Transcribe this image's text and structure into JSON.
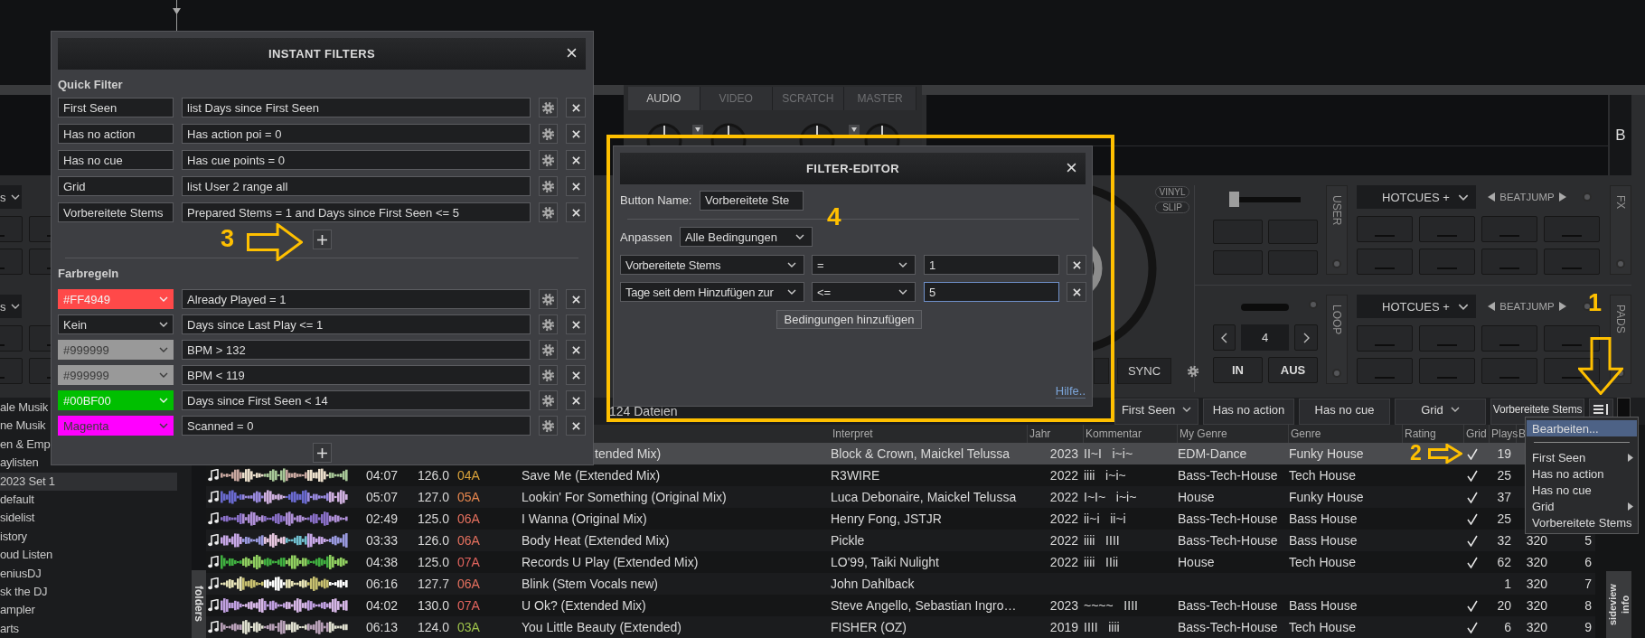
{
  "left_deck": {
    "hotcue_banks": [
      {
        "mode": "s"
      },
      {
        "mode": "s"
      }
    ]
  },
  "mixer": {
    "tabs": [
      {
        "label": "AUDIO",
        "selected": true
      },
      {
        "label": "VIDEO",
        "selected": false
      },
      {
        "label": "SCRATCH",
        "selected": false
      },
      {
        "label": "MASTER",
        "selected": false
      }
    ]
  },
  "deck_b": {
    "label": "B",
    "vinyl": "VINYL",
    "slip": "SLIP",
    "sync": "SYNC",
    "pitch": {
      "level": 0
    },
    "user_tab": "USER",
    "loop": {
      "tab": "LOOP",
      "size": "4",
      "in": "IN",
      "out": "AUS"
    },
    "pad_banks": [
      {
        "mode": "HOTCUES +",
        "beatjump": "BEATJUMP",
        "side_tab": "FX"
      },
      {
        "mode": "HOTCUES +",
        "beatjump": "BEATJUMP",
        "side_tab": "PADS"
      }
    ]
  },
  "sidebar": {
    "items": [
      {
        "label": "ale Musik",
        "selected": false
      },
      {
        "label": "ne Musik",
        "selected": false
      },
      {
        "label": "en & Emp",
        "selected": false
      },
      {
        "label": "aylisten",
        "selected": false
      },
      {
        "label": "2023 Set 1",
        "selected": true
      },
      {
        "label": "default",
        "selected": false
      },
      {
        "label": "sidelist",
        "selected": false
      },
      {
        "label": "istory",
        "selected": false
      },
      {
        "label": "oud Listen",
        "selected": false
      },
      {
        "label": "eniusDJ",
        "selected": false
      },
      {
        "label": "sk the DJ",
        "selected": false
      },
      {
        "label": "ampler",
        "selected": false
      },
      {
        "label": "arts",
        "selected": false
      }
    ],
    "tab": "folders"
  },
  "browser": {
    "file_count": "124 Dateien",
    "filter_buttons": [
      {
        "label": "First Seen",
        "dropdown": true
      },
      {
        "label": "Has no action",
        "dropdown": false
      },
      {
        "label": "Has no cue",
        "dropdown": false
      },
      {
        "label": "Grid",
        "dropdown": true
      },
      {
        "label": "Vorbereitete Stems",
        "dropdown": false
      }
    ],
    "columns": [
      "Interpret",
      "Jahr",
      "Kommentar",
      "My Genre",
      "Genre",
      "Rating",
      "Grid",
      "Plays",
      "B"
    ],
    "rows": [
      {
        "selected": true,
        "title": "tended Mix)",
        "artist": "Block & Crown, Maickel Telussa",
        "year": "2023",
        "comment": "II~I   i~i~",
        "my_genre": "EDM-Dance",
        "genre": "Funky House",
        "grid": true,
        "plays": "19"
      },
      {
        "selected": false,
        "time": "04:07",
        "bpm": "126.0",
        "key": "04A",
        "color": "#d9a23a",
        "title": "Save Me (Extended Mix)",
        "artist": "R3WIRE",
        "year": "2022",
        "comment": "iiii   i~i~",
        "my_genre": "Bass-Tech-House",
        "genre": "Tech House",
        "grid": true,
        "plays": "25"
      },
      {
        "selected": false,
        "time": "05:07",
        "bpm": "127.0",
        "key": "05A",
        "color": "#e8874e",
        "title": "Lookin' For Something (Original Mix)",
        "artist": "Luca Debonaire, Maickel Telussa",
        "year": "2022",
        "comment": "I~I~   i~i~",
        "my_genre": "House",
        "genre": "Funky House",
        "grid": true,
        "plays": "37"
      },
      {
        "selected": false,
        "time": "02:49",
        "bpm": "125.0",
        "key": "06A",
        "color": "#e5705e",
        "title": "I Wanna (Original Mix)",
        "artist": "Henry Fong, JSTJR",
        "year": "2022",
        "comment": "ii~i   ii~i",
        "my_genre": "Bass-Tech-House",
        "genre": "Bass House",
        "grid": true,
        "plays": "25"
      },
      {
        "selected": false,
        "time": "03:33",
        "bpm": "126.0",
        "key": "06A",
        "color": "#e5705e",
        "title": "Body Heat (Extended Mix)",
        "artist": "Pickle",
        "year": "2022",
        "comment": "iiii   IIII",
        "my_genre": "Bass-Tech-House",
        "genre": "Bass House",
        "grid": true,
        "plays": "32",
        "bitrate": "320",
        "number": "5"
      },
      {
        "selected": false,
        "time": "04:38",
        "bpm": "125.0",
        "key": "07A",
        "color": "#e2645e",
        "title": "Records U Play (Extended Mix)",
        "artist": "LO'99, Taiki Nulight",
        "year": "2022",
        "comment": "iiii   IIii",
        "my_genre": "House",
        "genre": "Tech House",
        "grid": true,
        "plays": "62",
        "bitrate": "320",
        "number": "6"
      },
      {
        "selected": false,
        "time": "06:16",
        "bpm": "127.7",
        "key": "06A",
        "color": "#e5705e",
        "title": "Blink (Stem Vocals new)",
        "artist": "John Dahlback",
        "grid": false,
        "plays": "1",
        "bitrate": "320",
        "number": "7"
      },
      {
        "selected": false,
        "time": "04:02",
        "bpm": "130.0",
        "key": "07A",
        "color": "#e2645e",
        "title": "U Ok? (Extended Mix)",
        "artist": "Steve Angello, Sebastian Ingro…",
        "year": "2023",
        "comment": "~~~~   IIII",
        "my_genre": "Bass-Tech-House",
        "genre": "Bass House",
        "grid": true,
        "plays": "20",
        "bitrate": "320",
        "number": "8"
      },
      {
        "selected": false,
        "time": "06:13",
        "bpm": "124.0",
        "key": "03A",
        "color": "#9dc24a",
        "title": "You Little Beauty (Extended)",
        "artist": "FISHER (OZ)",
        "year": "2019",
        "comment": "IIII   iiii",
        "my_genre": "Bass-Tech-House",
        "genre": "Tech House",
        "grid": true,
        "plays": "6",
        "bitrate": "320",
        "number": "9"
      }
    ],
    "side_tabs": [
      "sideview",
      "info"
    ]
  },
  "context_menu": {
    "items": [
      {
        "kind": "item",
        "label": "Bearbeiten...",
        "selected": true,
        "submenu": false
      },
      {
        "kind": "separator"
      },
      {
        "kind": "item",
        "label": "First Seen",
        "selected": false,
        "submenu": true
      },
      {
        "kind": "item",
        "label": "Has no action",
        "selected": false,
        "submenu": false
      },
      {
        "kind": "item",
        "label": "Has no cue",
        "selected": false,
        "submenu": false
      },
      {
        "kind": "item",
        "label": "Grid",
        "selected": false,
        "submenu": true
      },
      {
        "kind": "item",
        "label": "Vorbereitete Stems",
        "selected": false,
        "submenu": false
      }
    ]
  },
  "instant_filters": {
    "title": "INSTANT FILTERS",
    "quick_filter": {
      "heading": "Quick Filter",
      "rows": [
        {
          "name": "First Seen",
          "expression": "list Days since First Seen"
        },
        {
          "name": "Has no action",
          "expression": "Has action poi = 0"
        },
        {
          "name": "Has no cue",
          "expression": "Has cue points = 0"
        },
        {
          "name": "Grid",
          "expression": "list User 2 range all"
        },
        {
          "name": "Vorbereitete Stems",
          "expression": "Prepared Stems = 1 and Days since First Seen <= 5"
        }
      ]
    },
    "color_rules": {
      "heading": "Farbregeln",
      "rows": [
        {
          "label": "#FF4949",
          "color": "#ff4949",
          "expression": "Already Played = 1"
        },
        {
          "label": "Kein",
          "expression": "Days since Last Play <= 1"
        },
        {
          "label": "#999999",
          "color": "#999999",
          "expression": "BPM > 132"
        },
        {
          "label": "#999999",
          "color": "#999999",
          "expression": "BPM < 119"
        },
        {
          "label": "#00BF00",
          "color": "#00bf00",
          "expression": "Days since First Seen < 14"
        },
        {
          "label": "Magenta",
          "color": "#ff00ff",
          "expression": "Scanned = 0"
        }
      ]
    }
  },
  "filter_editor": {
    "title": "FILTER-EDITOR",
    "name_label": "Button Name:",
    "name_value": "Vorbereitete Ste",
    "match_label": "Anpassen",
    "match_value": "Alle Bedingungen",
    "conditions": [
      {
        "field": "Vorbereitete Stems",
        "operator": "=",
        "value": "1",
        "focused": false
      },
      {
        "field": "Tage seit dem Hinzufügen zur",
        "operator": "<=",
        "value": "5",
        "focused": true
      }
    ],
    "add_button": "Bedingungen hinzufügen",
    "help_link": "Hilfe.."
  },
  "annotations": [
    {
      "kind": "label",
      "label": "4"
    },
    {
      "kind": "arrow_right",
      "label": "3"
    },
    {
      "kind": "arrow_down",
      "label": "1"
    },
    {
      "kind": "arrow_right",
      "label": "2"
    }
  ]
}
